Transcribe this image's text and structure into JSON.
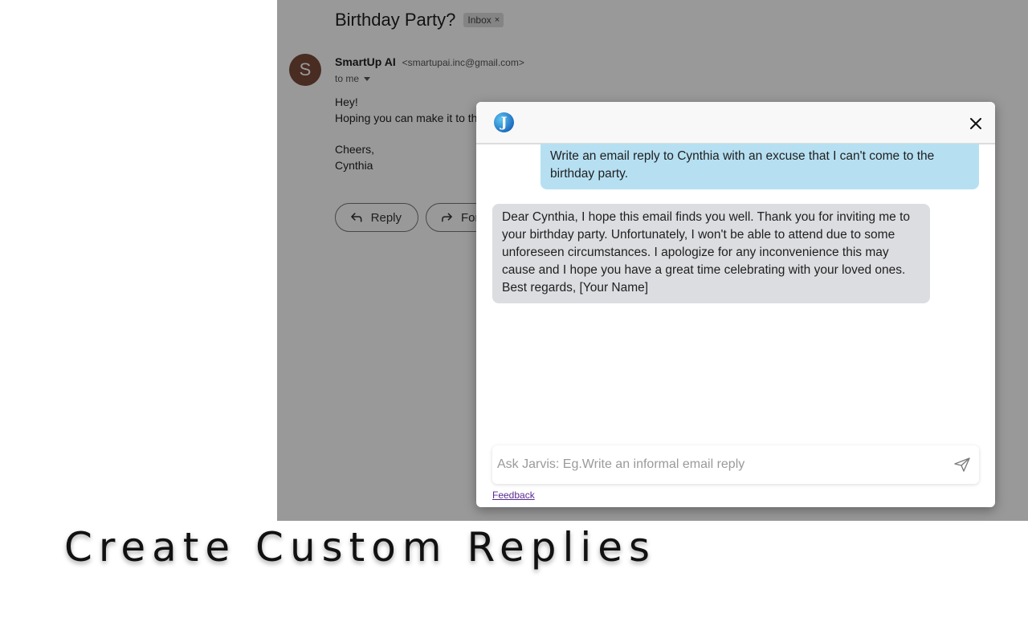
{
  "email": {
    "subject": "Birthday Party?",
    "label_chip": "Inbox",
    "label_chip_close": "×",
    "avatar_letter": "S",
    "sender_name": "SmartUp AI",
    "sender_email": "<smartupai.inc@gmail.com>",
    "recipient": "to me",
    "body_lines": [
      "Hey!",
      "Hoping you can make it to the",
      "",
      "Cheers,",
      "Cynthia"
    ],
    "actions": {
      "reply": "Reply",
      "forward": "Forward"
    }
  },
  "chat": {
    "logo_letter": "J",
    "close_icon": "close-icon",
    "user_message": "Write an email reply to Cynthia with an excuse that I can't come to the birthday party.",
    "bot_message": "Dear Cynthia, I hope this email finds you well. Thank you for inviting me to your birthday party. Unfortunately, I won't be able to attend due to some unforeseen circumstances. I apologize for any inconvenience this may cause and I hope you have a great time celebrating with your loved ones. Best regards, [Your Name]",
    "input": {
      "value": "",
      "placeholder": "Ask Jarvis: Eg.Write an informal email reply"
    },
    "send_icon": "send-icon",
    "feedback_label": "Feedback"
  },
  "promo": {
    "heading": "Create Custom Replies"
  },
  "colors": {
    "user_bubble": "#b6e0f2",
    "bot_bubble": "#dcdde0",
    "avatar": "#7a4a3a",
    "feedback_link": "#5b2a91"
  }
}
